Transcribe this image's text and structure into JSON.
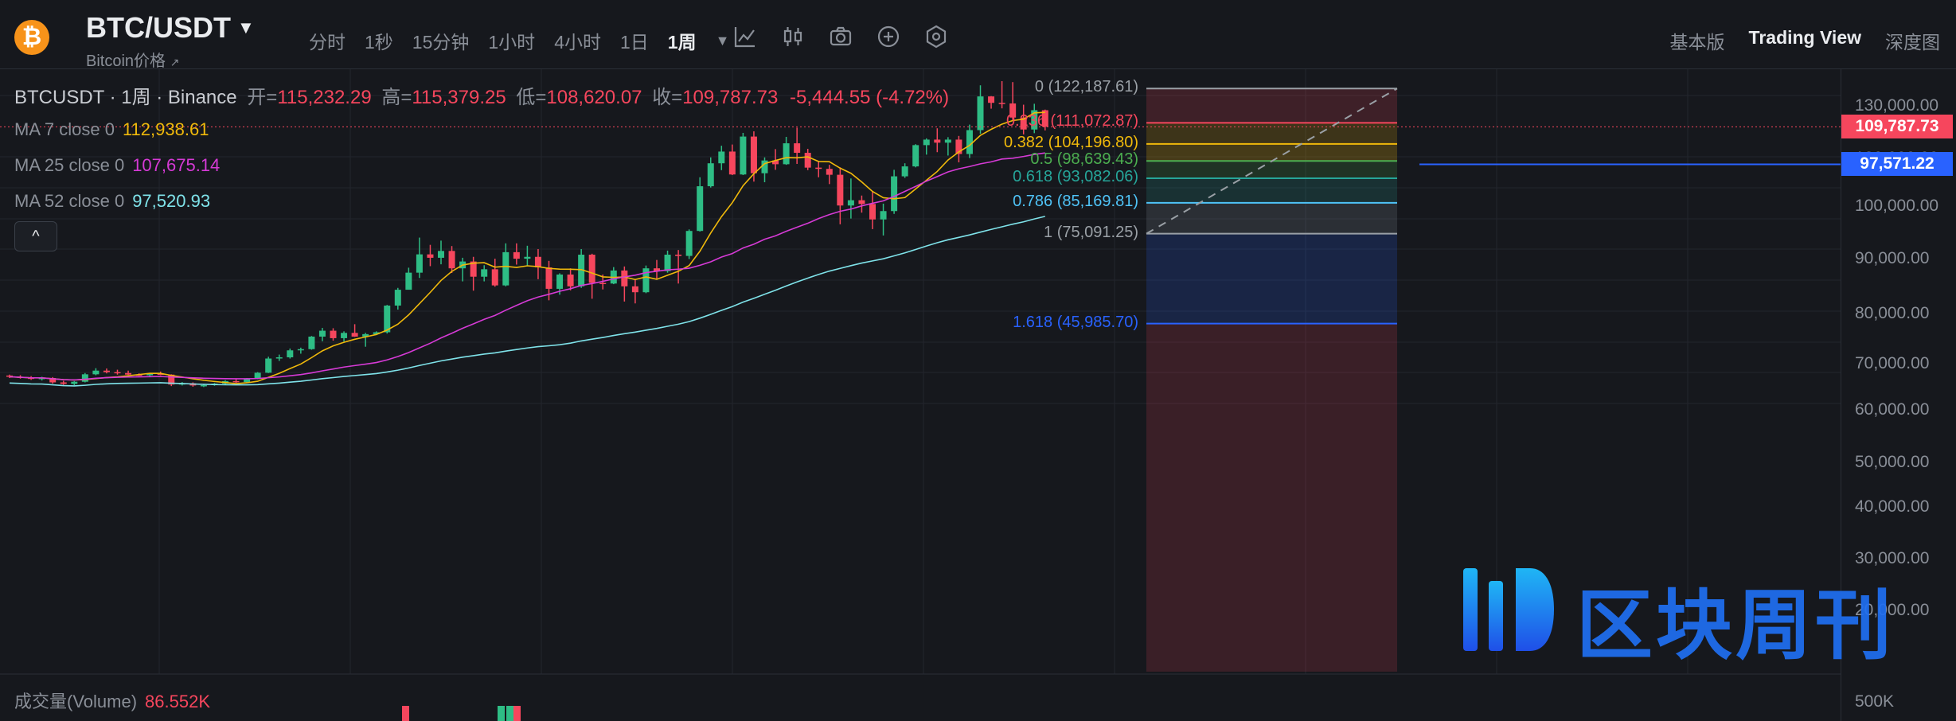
{
  "header": {
    "pair": "BTC/USDT",
    "subtitle": "Bitcoin价格",
    "subtitle_arrow": "↗",
    "coin_symbol": "₿",
    "intervals": [
      "分时",
      "1秒",
      "15分钟",
      "1小时",
      "4小时",
      "1日",
      "1周"
    ],
    "active_interval": "1周",
    "views": [
      "基本版",
      "Trading View",
      "深度图"
    ],
    "active_view": "Trading View",
    "icons": [
      "indicator-icon",
      "candle-type-icon",
      "camera-icon",
      "add-icon",
      "settings-hex-icon"
    ]
  },
  "legend": {
    "symbol": "BTCUSDT · 1周 · Binance",
    "open_label": "开=",
    "open": "115,232.29",
    "high_label": "高=",
    "high": "115,379.25",
    "low_label": "低=",
    "low": "108,620.07",
    "close_label": "收=",
    "close": "109,787.73",
    "change": "-5,444.55 (-4.72%)"
  },
  "ma": [
    {
      "label": "MA 7 close 0",
      "value": "112,938.61",
      "color": "#f0b90b"
    },
    {
      "label": "MA 25 close 0",
      "value": "107,675.14",
      "color": "#d63ad6"
    },
    {
      "label": "MA 52 close 0",
      "value": "97,520.93",
      "color": "#7fe3ea"
    }
  ],
  "collapse_symbol": "^",
  "volume": {
    "label": "成交量(Volume)",
    "value": "86.552K"
  },
  "axis": {
    "ticks": [
      "130,000.00",
      "120,000.00",
      "100,000.00",
      "90,000.00",
      "80,000.00",
      "70,000.00",
      "60,000.00",
      "50,000.00",
      "40,000.00",
      "30,000.00",
      "20,000.00",
      "500K"
    ],
    "current_price": "109,787.73",
    "current_price_color": "#f6465d",
    "ma52_tag": "97,571.22",
    "ma52_tag_color": "#2962ff"
  },
  "fib": [
    {
      "label": "0 (122,187.61)",
      "color": "#9aa0a6"
    },
    {
      "label": "0.236 (111,072.87)",
      "color": "#f6465d"
    },
    {
      "label": "0.382 (104,196.80)",
      "color": "#f0b90b"
    },
    {
      "label": "0.5 (98,639.43)",
      "color": "#4caf50"
    },
    {
      "label": "0.618 (93,082.06)",
      "color": "#26a69a"
    },
    {
      "label": "0.786 (85,169.81)",
      "color": "#4fc3f7"
    },
    {
      "label": "1 (75,091.25)",
      "color": "#9aa0a6"
    },
    {
      "label": "1.618 (45,985.70)",
      "color": "#2962ff"
    }
  ],
  "watermark": {
    "text": "区块周刊"
  },
  "chart_data": {
    "type": "candlestick",
    "y_scale": "log",
    "ylim": [
      20000,
      135000
    ],
    "candles": [
      [
        29000,
        29300,
        28200,
        28600
      ],
      [
        28600,
        29100,
        28000,
        28300
      ],
      [
        28300,
        28800,
        27600,
        27900
      ],
      [
        27900,
        28600,
        27400,
        28200
      ],
      [
        28200,
        28500,
        26400,
        26800
      ],
      [
        26800,
        27300,
        26000,
        26300
      ],
      [
        26300,
        27200,
        25900,
        27000
      ],
      [
        27000,
        29800,
        26800,
        29400
      ],
      [
        29400,
        31400,
        29100,
        30600
      ],
      [
        30600,
        31300,
        29700,
        30100
      ],
      [
        30100,
        30900,
        29300,
        29800
      ],
      [
        29800,
        30600,
        29200,
        29300
      ],
      [
        29300,
        29700,
        28900,
        29100
      ],
      [
        29100,
        29800,
        28600,
        29600
      ],
      [
        29600,
        30300,
        29100,
        29300
      ],
      [
        29300,
        29400,
        25600,
        26100
      ],
      [
        26100,
        26900,
        25800,
        26500
      ],
      [
        26500,
        26800,
        25400,
        25800
      ],
      [
        25800,
        26300,
        25300,
        25900
      ],
      [
        25900,
        26600,
        25700,
        26400
      ],
      [
        26400,
        27500,
        26100,
        27200
      ],
      [
        27200,
        28000,
        26600,
        26900
      ],
      [
        26900,
        28200,
        26600,
        28000
      ],
      [
        28000,
        30100,
        27800,
        29900
      ],
      [
        29900,
        35200,
        29800,
        34600
      ],
      [
        34600,
        35900,
        33800,
        35000
      ],
      [
        35000,
        37900,
        34600,
        37300
      ],
      [
        37300,
        38200,
        36200,
        37700
      ],
      [
        37700,
        42000,
        37500,
        41800
      ],
      [
        41800,
        44600,
        40300,
        43700
      ],
      [
        43700,
        44500,
        40500,
        41300
      ],
      [
        41300,
        43500,
        40200,
        43000
      ],
      [
        43000,
        45800,
        41700,
        41800
      ],
      [
        41800,
        43000,
        38500,
        42600
      ],
      [
        42600,
        43500,
        42300,
        43200
      ],
      [
        43200,
        52000,
        42800,
        51800
      ],
      [
        51800,
        57500,
        50500,
        56900
      ],
      [
        56900,
        64000,
        59100,
        62400
      ],
      [
        62400,
        73800,
        60700,
        68300
      ],
      [
        68300,
        71400,
        64500,
        67200
      ],
      [
        67200,
        72800,
        65100,
        69400
      ],
      [
        69400,
        71000,
        62300,
        63800
      ],
      [
        63800,
        67200,
        59600,
        66000
      ],
      [
        66000,
        67500,
        56600,
        61100
      ],
      [
        61100,
        64800,
        59600,
        63500
      ],
      [
        63500,
        66900,
        57900,
        58300
      ],
      [
        58300,
        71900,
        58000,
        69000
      ],
      [
        69000,
        71900,
        65000,
        66900
      ],
      [
        66900,
        71100,
        64500,
        67500
      ],
      [
        67500,
        70000,
        60300,
        64100
      ],
      [
        64100,
        66200,
        53500,
        57200
      ],
      [
        57200,
        62200,
        55300,
        61800
      ],
      [
        61800,
        63800,
        56700,
        58000
      ],
      [
        58000,
        70000,
        57500,
        68200
      ],
      [
        68200,
        68500,
        54000,
        59100
      ],
      [
        59100,
        61800,
        57000,
        58900
      ],
      [
        58900,
        64200,
        58700,
        63100
      ],
      [
        63100,
        64400,
        53100,
        58000
      ],
      [
        58000,
        60400,
        52500,
        56100
      ],
      [
        56100,
        64700,
        55800,
        63800
      ],
      [
        63800,
        66500,
        60500,
        62900
      ],
      [
        62900,
        69500,
        62400,
        68200
      ],
      [
        68200,
        69700,
        58900,
        67800
      ],
      [
        67800,
        76500,
        66800,
        76000
      ],
      [
        76000,
        93400,
        75800,
        90500
      ],
      [
        90500,
        99800,
        90100,
        97900
      ],
      [
        97900,
        103600,
        95700,
        101700
      ],
      [
        101700,
        104000,
        94100,
        94300
      ],
      [
        94300,
        107800,
        94100,
        106600
      ],
      [
        106600,
        108300,
        92000,
        94700
      ],
      [
        94700,
        99800,
        91800,
        98800
      ],
      [
        98800,
        102500,
        95800,
        97600
      ],
      [
        97600,
        106500,
        97400,
        104400
      ],
      [
        104400,
        109500,
        97700,
        101300
      ],
      [
        101300,
        102600,
        95700,
        96500
      ],
      [
        96500,
        98700,
        93400,
        96100
      ],
      [
        96100,
        97400,
        91200,
        94200
      ],
      [
        94200,
        96600,
        78200,
        84300
      ],
      [
        84300,
        93000,
        80100,
        86000
      ],
      [
        86000,
        87500,
        82000,
        84800
      ],
      [
        84800,
        88700,
        76600,
        79800
      ],
      [
        79800,
        84900,
        74500,
        82500
      ],
      [
        82500,
        95800,
        81600,
        93700
      ],
      [
        93700,
        97900,
        93200,
        96900
      ],
      [
        96900,
        104100,
        96600,
        103800
      ],
      [
        103800,
        106000,
        100700,
        105600
      ],
      [
        105600,
        109300,
        101500,
        104600
      ],
      [
        104600,
        106400,
        100400,
        105600
      ],
      [
        105600,
        106800,
        98200,
        100900
      ],
      [
        100900,
        110500,
        99600,
        108700
      ],
      [
        108700,
        123200,
        107500,
        119700
      ],
      [
        119700,
        119800,
        115700,
        117600
      ],
      [
        117600,
        124500,
        115800,
        117400
      ],
      [
        117400,
        124200,
        112000,
        112800
      ],
      [
        112800,
        117000,
        107300,
        108900
      ],
      [
        108900,
        117300,
        107700,
        115200
      ],
      [
        115200,
        115400,
        108600,
        109800
      ]
    ],
    "ma7_ends": [
      112938.61
    ],
    "ma25_end": 107675.14,
    "ma52_end": 97520.93,
    "fib_levels": [
      {
        "ratio": 0,
        "price": 122187.61
      },
      {
        "ratio": 0.236,
        "price": 111072.87
      },
      {
        "ratio": 0.382,
        "price": 104196.8
      },
      {
        "ratio": 0.5,
        "price": 98639.43
      },
      {
        "ratio": 0.618,
        "price": 93082.06
      },
      {
        "ratio": 0.786,
        "price": 85169.81
      },
      {
        "ratio": 1,
        "price": 75091.25
      },
      {
        "ratio": 1.618,
        "price": 45985.7
      }
    ]
  }
}
